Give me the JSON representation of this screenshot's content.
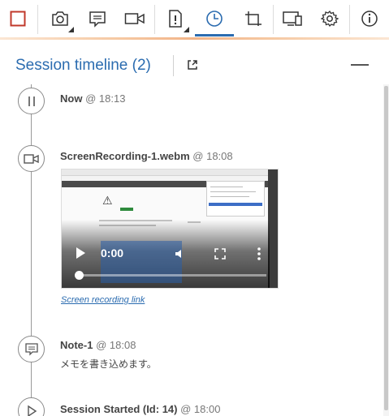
{
  "toolbar": {
    "accent_color": "#2b6cb0",
    "active_tool": "timeline",
    "items": [
      {
        "name": "stop-recording",
        "icon": "stop-square-icon"
      },
      {
        "name": "capture-screenshot",
        "icon": "camera-icon"
      },
      {
        "name": "add-note",
        "icon": "note-icon"
      },
      {
        "name": "record-video",
        "icon": "video-icon"
      },
      {
        "name": "report-bug",
        "icon": "bug-report-icon"
      },
      {
        "name": "timeline",
        "icon": "clock-icon"
      },
      {
        "name": "rotate",
        "icon": "crop-rotate-icon"
      },
      {
        "name": "device",
        "icon": "device-icon"
      },
      {
        "name": "settings",
        "icon": "gear-icon"
      },
      {
        "name": "info",
        "icon": "info-icon"
      }
    ]
  },
  "header": {
    "title": "Session timeline (2)"
  },
  "timeline": {
    "entries": [
      {
        "name": "Now",
        "time": "@ 18:13",
        "icon": "pause-icon"
      },
      {
        "name": "ScreenRecording-1.webm",
        "time": "@ 18:08",
        "icon": "video-icon",
        "video": {
          "current_time": "0:00",
          "progress": 0
        },
        "link": "Screen recording link"
      },
      {
        "name": "Note-1",
        "time": "@ 18:08",
        "icon": "note-icon",
        "text": "メモを書き込めます。"
      },
      {
        "name": "Session Started (Id: 14)",
        "time": "@ 18:00",
        "icon": "play-icon"
      }
    ]
  }
}
